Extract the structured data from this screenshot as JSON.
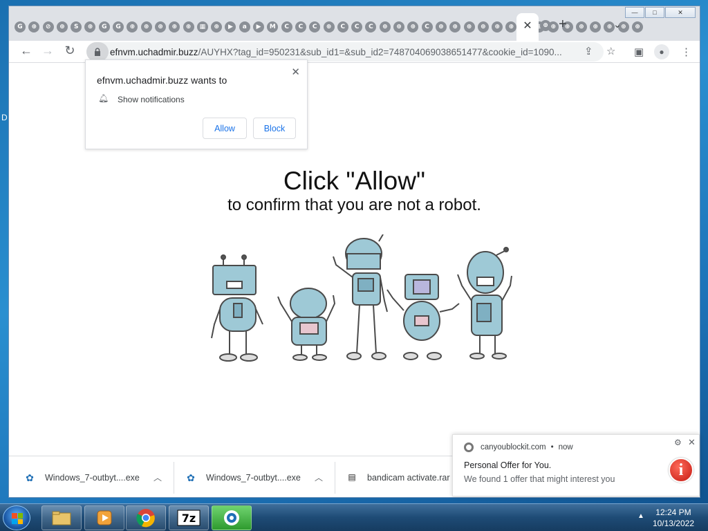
{
  "desktop": {
    "edge_letter": "D"
  },
  "browser": {
    "tab_favicons": [
      "G",
      "⊕",
      "⊘",
      "⊕",
      "S",
      "⊕",
      "G",
      "G",
      "⊕",
      "⊕",
      "⊕",
      "⊕",
      "⊕",
      "▦",
      "⊕",
      "▶",
      "a",
      "▶",
      "M",
      "C",
      "C",
      "C",
      "⊕",
      "C",
      "C",
      "C",
      "⊕",
      "⊕",
      "⊕",
      "C",
      "⊕",
      "⊕",
      "⊕",
      "⊕",
      "⊕",
      "⊕",
      "⊕",
      "⊕",
      "⊕",
      "⊕",
      "⊕",
      "⊕",
      "⊕",
      "⊕",
      "⊕"
    ],
    "tab_close": "✕",
    "new_tab": "+",
    "url_host": "efnvm.uchadmir.buzz",
    "url_path": "/AUYHX?tag_id=950231&sub_id1=&sub_id2=748704069038651477&cookie_id=1090...",
    "window_controls": {
      "minimize": "—",
      "maximize": "□",
      "close": "✕"
    }
  },
  "permission_prompt": {
    "title": "efnvm.uchadmir.buzz wants to",
    "permission": "Show notifications",
    "allow": "Allow",
    "block": "Block",
    "close": "✕"
  },
  "page": {
    "headline": "Click \"Allow\"",
    "subline": "to confirm that you are not a robot."
  },
  "downloads": [
    {
      "name": "Windows_7-outbyt....exe",
      "icon": "gear-icon"
    },
    {
      "name": "Windows_7-outbyt....exe",
      "icon": "gear-icon"
    },
    {
      "name": "bandicam activate.rar",
      "icon": "archive-icon"
    }
  ],
  "notification": {
    "source": "canyoublockit.com",
    "time": "now",
    "dot": "•",
    "title": "Personal Offer for You.",
    "body": "We found 1 offer that might interest you",
    "info_glyph": "i"
  },
  "taskbar": {
    "time": "12:24 PM",
    "date": "10/13/2022"
  }
}
